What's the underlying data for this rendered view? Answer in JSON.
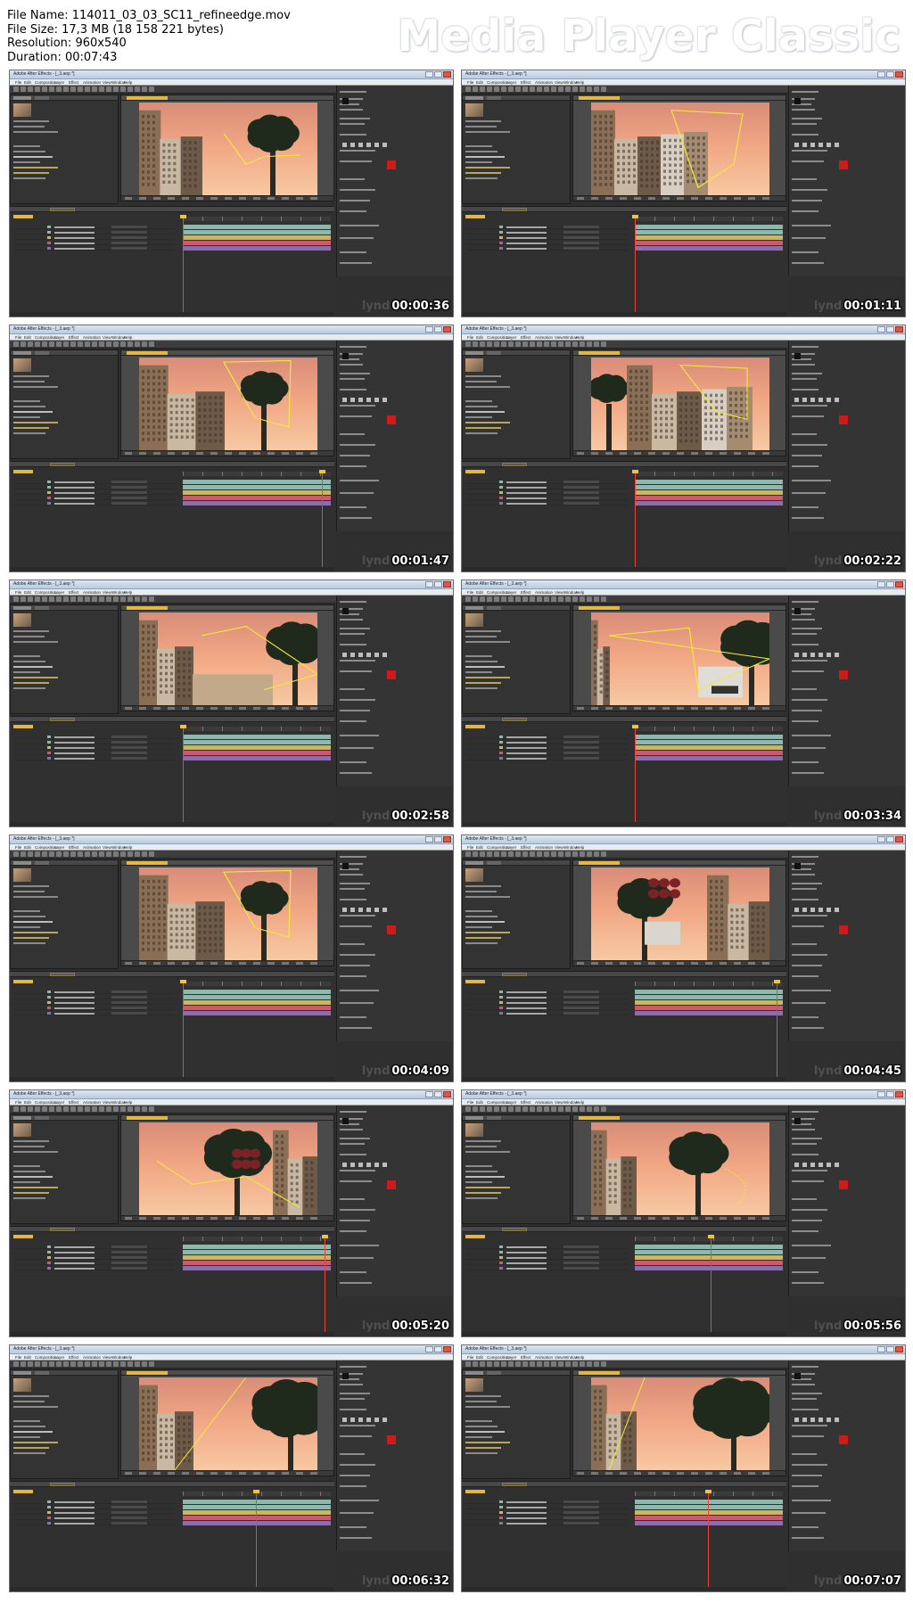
{
  "file_info": {
    "name": "File Name: 114011_03_03_SC11_refineedge.mov",
    "size": "File Size: 17,3 MB (18 158 221 bytes)",
    "resolution": "Resolution: 960x540",
    "duration": "Duration: 00:07:43"
  },
  "player_brand": "Media Player Classic",
  "colors": {
    "page_bg": "#ffffff",
    "ae_panel": "#333333",
    "timecode_yellow": "#e2b742",
    "track_yellow": "#f2ea3a",
    "layer_teal": "#8fb7ae",
    "layer_pink": "#c85a72",
    "cti_red": "#e8473a"
  },
  "app": {
    "window_title": "Adobe After Effects - [_3.aep *]",
    "menu": [
      "File",
      "Edit",
      "Composition",
      "Layer",
      "Effect",
      "Animation",
      "View",
      "Window",
      "Help"
    ]
  },
  "watermark_logo": "lynd",
  "frames": [
    {
      "timestamp": "00:00:36",
      "scene": "buildings",
      "cti": 0.0
    },
    {
      "timestamp": "00:01:11",
      "scene": "buildings-right",
      "cti": 0.0
    },
    {
      "timestamp": "00:01:47",
      "scene": "buildings-tree",
      "cti": 0.95
    },
    {
      "timestamp": "00:02:22",
      "scene": "buildings-wide",
      "cti": 0.0
    },
    {
      "timestamp": "00:02:58",
      "scene": "closeup",
      "cti": 0.0
    },
    {
      "timestamp": "00:03:34",
      "scene": "closeup-sign",
      "cti": 0.0
    },
    {
      "timestamp": "00:04:09",
      "scene": "buildings-tree",
      "cti": 0.0
    },
    {
      "timestamp": "00:04:45",
      "scene": "flowers",
      "cti": 0.97
    },
    {
      "timestamp": "00:05:20",
      "scene": "flowers-mask",
      "cti": 0.97
    },
    {
      "timestamp": "00:05:56",
      "scene": "closeup-mask",
      "cti": 0.52
    },
    {
      "timestamp": "00:06:32",
      "scene": "sky-curves",
      "cti": 0.5
    },
    {
      "timestamp": "00:07:07",
      "scene": "sky-matte",
      "cti": 0.5
    }
  ]
}
